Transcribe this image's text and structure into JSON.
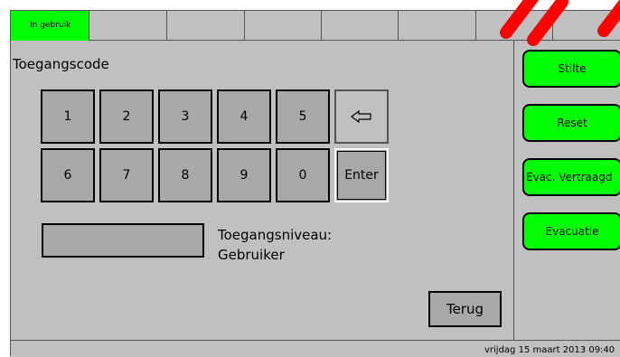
{
  "tabs": [
    {
      "label": "In gebruik",
      "active": true
    },
    {
      "label": ""
    },
    {
      "label": ""
    },
    {
      "label": ""
    },
    {
      "label": ""
    },
    {
      "label": ""
    },
    {
      "label": ""
    },
    {
      "label": ""
    }
  ],
  "page": {
    "title": "Toegangscode"
  },
  "keypad": {
    "row1": [
      "1",
      "2",
      "3",
      "4",
      "5"
    ],
    "row2": [
      "6",
      "7",
      "8",
      "9",
      "0"
    ],
    "backspace_icon": "arrow-left-outline-icon",
    "enter": "Enter"
  },
  "access": {
    "label": "Toegangsniveau:",
    "value": "Gebruiker"
  },
  "buttons": {
    "back": "Terug"
  },
  "sidebar": {
    "stilte": "Stilte",
    "reset": "Reset",
    "evac_delayed": "Evac. Vertraagd",
    "evacuation": "Evacuatie"
  },
  "status": {
    "datetime": "vrijdag 15 maart 2013 09:40"
  },
  "colors": {
    "panel": "#c0c0c0",
    "key": "#a8a8a8",
    "accent_green": "#00ff00",
    "overlay_red": "#ff0000"
  }
}
